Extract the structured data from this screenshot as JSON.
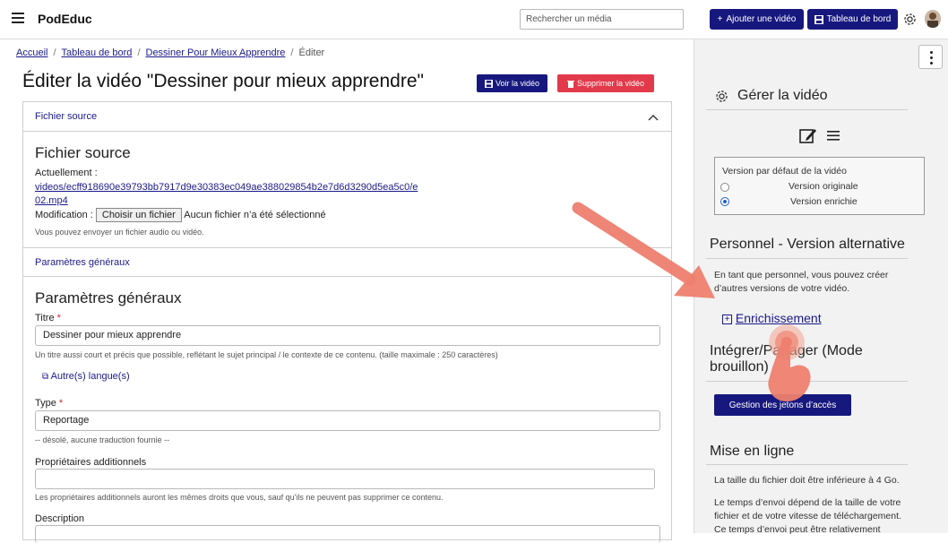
{
  "header": {
    "brand": "PodEduc",
    "search_placeholder": "Rechercher un média",
    "add_video_label": "Ajouter une vidéo",
    "dashboard_label": "Tableau de bord"
  },
  "breadcrumb": {
    "items": [
      "Accueil",
      "Tableau de bord",
      "Dessiner Pour Mieux Apprendre"
    ],
    "current": "Éditer"
  },
  "page": {
    "title": "Éditer la vidéo \"Dessiner pour mieux apprendre\"",
    "view_label": "Voir la vidéo",
    "delete_label": "Supprimer la vidéo"
  },
  "source": {
    "section_label": "Fichier source",
    "heading": "Fichier source",
    "current_label": "Actuellement :",
    "current_link_line1": "videos/ecff918690e39793bb7917d9e30383ec049ae388029854b2e7d6d3290d5ea5c0/e",
    "current_link_line2": "02.mp4",
    "modification_label": "Modification :",
    "choose_label": "Choisir un fichier",
    "no_file": "Aucun fichier n’a été sélectionné",
    "help": "Vous pouvez envoyer un fichier audio ou vidéo."
  },
  "general": {
    "section_label": "Paramètres généraux",
    "heading": "Paramètres généraux",
    "title_label": "Titre",
    "title_value": "Dessiner pour mieux apprendre",
    "title_help": "Un titre aussi court et précis que possible, reflétant le sujet principal / le contexte de ce contenu. (taille maximale : 250 caractères)",
    "other_lang": "Autre(s) langue(s)",
    "type_label": "Type",
    "type_value": "Reportage",
    "type_help": "-- désolé, aucune traduction fournie --",
    "owners_label": "Propriétaires additionnels",
    "owners_help": "Les propriétaires additionnels auront les mêmes droits que vous, sauf qu'ils ne peuvent pas supprimer ce contenu.",
    "description_label": "Description",
    "required_mark": "*"
  },
  "right_panel": {
    "manage_heading": "Gérer la vidéo",
    "version_title": "Version par défaut de la vidéo",
    "version_original": "Version originale",
    "version_enriched": "Version enrichie",
    "selected_version": "Version enrichie",
    "staff_heading": "Personnel - Version alternative",
    "staff_text_1": "En tant que personnel, vous pouvez créer",
    "staff_text_2": "d’autres versions de votre vidéo.",
    "enrich_link": "Enrichissement",
    "embed_heading_1": "Intégrer/Partager (Mode",
    "embed_heading_2": "brouillon)",
    "tokens_button": "Gestion des jetons d’accès",
    "upload_heading": "Mise en ligne",
    "upload_text_1": "La taille du fichier doit être inférieure à 4 Go.",
    "upload_text_2": "Le temps d’envoi dépend de la taille de votre",
    "upload_text_3": "fichier et de votre vitesse de téléchargement.",
    "upload_text_4": "Ce temps d’envoi peut être relativement"
  },
  "colors": {
    "navy": "#17187e",
    "danger": "#e23a4a",
    "link": "#1a1a8a",
    "annotation": "#ee7f6f"
  }
}
